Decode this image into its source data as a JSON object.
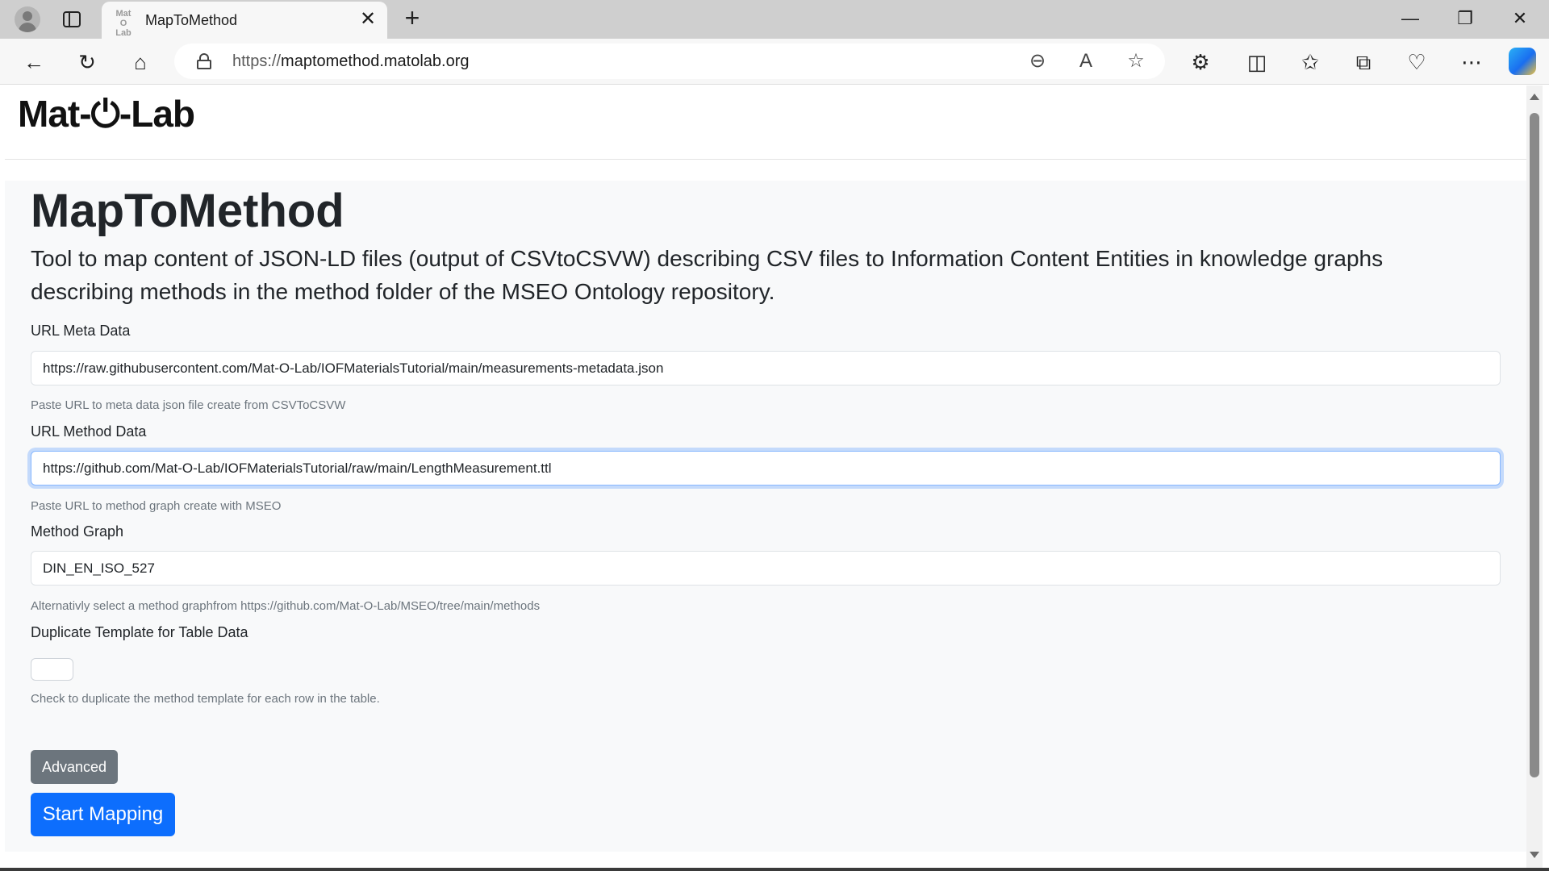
{
  "browser": {
    "tab_title": "MapToMethod",
    "favicon_text": "Mat O Lab",
    "url_protocol": "https://",
    "url_host": "maptomethod.matolab.org"
  },
  "site": {
    "brand": "Mat-⏻-Lab"
  },
  "main": {
    "title": "MapToMethod",
    "lead": "Tool to map content of JSON-LD files (output of CSVtoCSVW) describing CSV files to Information Content Entities in knowledge graphs describing methods in the method folder of the MSEO Ontology repository."
  },
  "form": {
    "meta": {
      "label": "URL Meta Data",
      "value": "https://raw.githubusercontent.com/Mat-O-Lab/IOFMaterialsTutorial/main/measurements-metadata.json",
      "help": "Paste URL to meta data json file create from CSVToCSVW"
    },
    "method": {
      "label": "URL Method Data",
      "value": "https://github.com/Mat-O-Lab/IOFMaterialsTutorial/raw/main/LengthMeasurement.ttl",
      "help": "Paste URL to method graph create with MSEO"
    },
    "graph": {
      "label": "Method Graph",
      "value": "DIN_EN_ISO_527",
      "help": "Alternativly select a method graphfrom https://github.com/Mat-O-Lab/MSEO/tree/main/methods"
    },
    "duplicate": {
      "label": "Duplicate Template for Table Data",
      "checked": false,
      "help": "Check to duplicate the method template for each row in the table."
    },
    "advanced_label": "Advanced",
    "start_label": "Start Mapping"
  },
  "colors": {
    "primary": "#0d6efd",
    "secondary": "#6c757d",
    "page_bg": "#f8f9fa"
  }
}
